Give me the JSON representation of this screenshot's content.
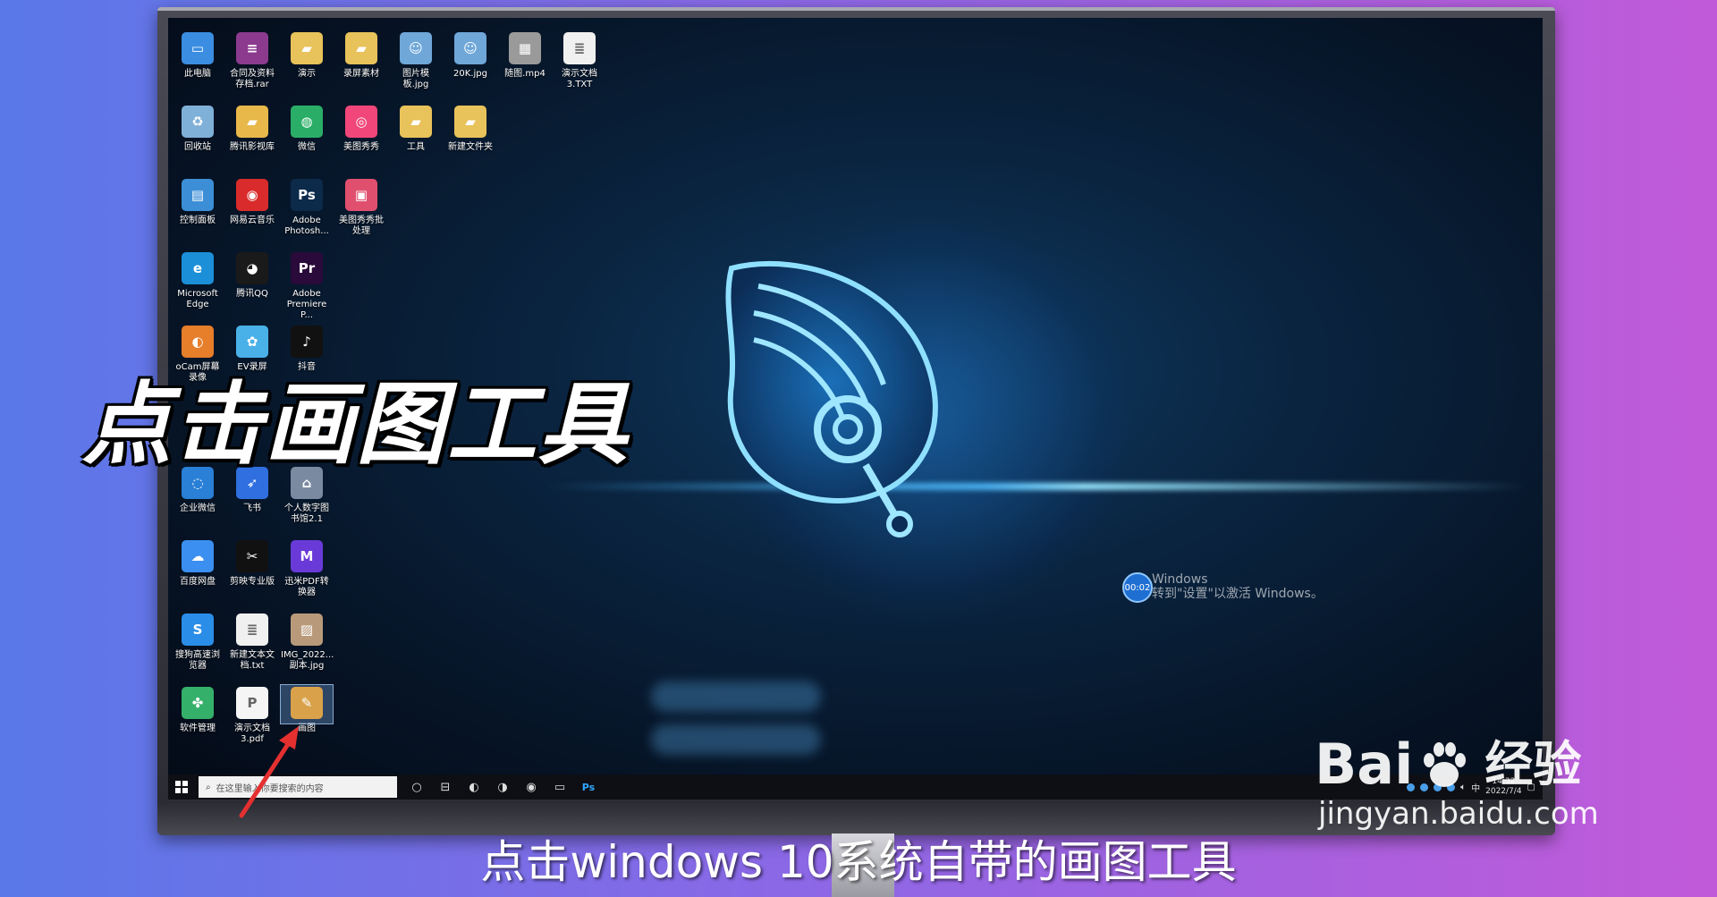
{
  "desktop_icons": [
    {
      "label": "此电脑",
      "icon": "computer-icon",
      "color": "#3a8de0",
      "glyph": "▭"
    },
    {
      "label": "合同及资料存档.rar",
      "icon": "winrar-icon",
      "color": "#8b3a8e",
      "glyph": "≡"
    },
    {
      "label": "演示",
      "icon": "folder-icon",
      "color": "#e8c25a",
      "glyph": "▰"
    },
    {
      "label": "录屏素材",
      "icon": "folder-icon",
      "color": "#e8c25a",
      "glyph": "▰"
    },
    {
      "label": "图片模板.jpg",
      "icon": "image-icon",
      "color": "#6fa7d8",
      "glyph": "☺"
    },
    {
      "label": "20K.jpg",
      "icon": "image-icon",
      "color": "#6fa7d8",
      "glyph": "☺"
    },
    {
      "label": "随图.mp4",
      "icon": "video-file-icon",
      "color": "#9a9a9a",
      "glyph": "▦"
    },
    {
      "label": "演示文档3.TXT",
      "icon": "text-file-icon",
      "color": "#f0f0f0",
      "glyph": "≣"
    },
    {
      "label": "回收站",
      "icon": "recycle-bin-icon",
      "color": "#7fb0d8",
      "glyph": "♻"
    },
    {
      "label": "腾讯影视库",
      "icon": "folder-icon",
      "color": "#e8b84a",
      "glyph": "▰"
    },
    {
      "label": "微信",
      "icon": "wechat-icon",
      "color": "#2aae67",
      "glyph": "◍"
    },
    {
      "label": "美图秀秀",
      "icon": "meitu-icon",
      "color": "#f0467a",
      "glyph": "◎"
    },
    {
      "label": "工具",
      "icon": "folder-icon",
      "color": "#e8c25a",
      "glyph": "▰"
    },
    {
      "label": "新建文件夹",
      "icon": "folder-icon",
      "color": "#e8c25a",
      "glyph": "▰"
    },
    {
      "label": "控制面板",
      "icon": "control-panel-icon",
      "color": "#3c8ed6",
      "glyph": "▤"
    },
    {
      "label": "网易云音乐",
      "icon": "netease-music-icon",
      "color": "#d92b2b",
      "glyph": "◉"
    },
    {
      "label": "Adobe Photosh...",
      "icon": "photoshop-icon",
      "color": "#0c2a4a",
      "glyph": "Ps"
    },
    {
      "label": "美图秀秀批处理",
      "icon": "meitu-batch-icon",
      "color": "#e0506e",
      "glyph": "▣"
    },
    {
      "label": "Microsoft Edge",
      "icon": "edge-icon",
      "color": "#1b8fd8",
      "glyph": "e"
    },
    {
      "label": "腾讯QQ",
      "icon": "qq-icon",
      "color": "#1a1a1a",
      "glyph": "◕"
    },
    {
      "label": "Adobe Premiere P...",
      "icon": "premiere-icon",
      "color": "#2a0a3a",
      "glyph": "Pr"
    },
    {
      "label": "oCam屏幕录像",
      "icon": "ocam-icon",
      "color": "#e67e2a",
      "glyph": "◐"
    },
    {
      "label": "EV录屏",
      "icon": "ev-recorder-icon",
      "color": "#4ab0e8",
      "glyph": "✿"
    },
    {
      "label": "抖音",
      "icon": "douyin-icon",
      "color": "#111111",
      "glyph": "♪"
    },
    {
      "label": "企业微信",
      "icon": "wecom-icon",
      "color": "#2a7fd6",
      "glyph": "◌"
    },
    {
      "label": "飞书",
      "icon": "feishu-icon",
      "color": "#2f6fe0",
      "glyph": "➶"
    },
    {
      "label": "个人数字图书馆2.1",
      "icon": "library-icon",
      "color": "#7a8aa0",
      "glyph": "⌂"
    },
    {
      "label": "百度网盘",
      "icon": "baidu-netdisk-icon",
      "color": "#3b8ff0",
      "glyph": "☁"
    },
    {
      "label": "剪映专业版",
      "icon": "jianying-icon",
      "color": "#111111",
      "glyph": "✂"
    },
    {
      "label": "迅米PDF转换器",
      "icon": "pdf-converter-icon",
      "color": "#6a3ad8",
      "glyph": "M"
    },
    {
      "label": "搜狗高速浏览器",
      "icon": "sogou-browser-icon",
      "color": "#2a8de8",
      "glyph": "S"
    },
    {
      "label": "新建文本文档.txt",
      "icon": "text-file-icon",
      "color": "#f0f0f0",
      "glyph": "≣"
    },
    {
      "label": "IMG_2022...副本.jpg",
      "icon": "image-icon",
      "color": "#b89a7a",
      "glyph": "▨"
    },
    {
      "label": "软件管理",
      "icon": "software-manager-icon",
      "color": "#35b06a",
      "glyph": "✤"
    },
    {
      "label": "演示文档3.pdf",
      "icon": "pdf-file-icon",
      "color": "#f5f5f5",
      "glyph": "P"
    },
    {
      "label": "画图",
      "icon": "paint-icon",
      "color": "#d9a24a",
      "glyph": "✎",
      "selected": true
    }
  ],
  "taskbar": {
    "search_placeholder": "在这里输入你要搜索的内容",
    "apps": [
      {
        "name": "task-view-icon",
        "glyph": "○"
      },
      {
        "name": "multitask-icon",
        "glyph": "⊟"
      },
      {
        "name": "sogou-taskbar-icon",
        "glyph": "◐"
      },
      {
        "name": "edge-taskbar-icon",
        "glyph": "◑"
      },
      {
        "name": "browser-taskbar-icon",
        "glyph": "◉"
      },
      {
        "name": "file-explorer-icon",
        "glyph": "▭"
      },
      {
        "name": "photoshop-taskbar-icon",
        "glyph": "Ps"
      }
    ],
    "tray_lang": "中",
    "clock_time": "14:32",
    "clock_date": "2022/7/4"
  },
  "activation": {
    "timer": "00:02",
    "line1": "Windows",
    "line2": "转到\"设置\"以激活 Windows。"
  },
  "overlay": {
    "big_caption": "点击画图工具",
    "subtitle": "点击windows 10系统自带的画图工具"
  },
  "watermark": {
    "brand_left": "Bai",
    "brand_right": "经验",
    "url": "jingyan.baidu.com"
  }
}
